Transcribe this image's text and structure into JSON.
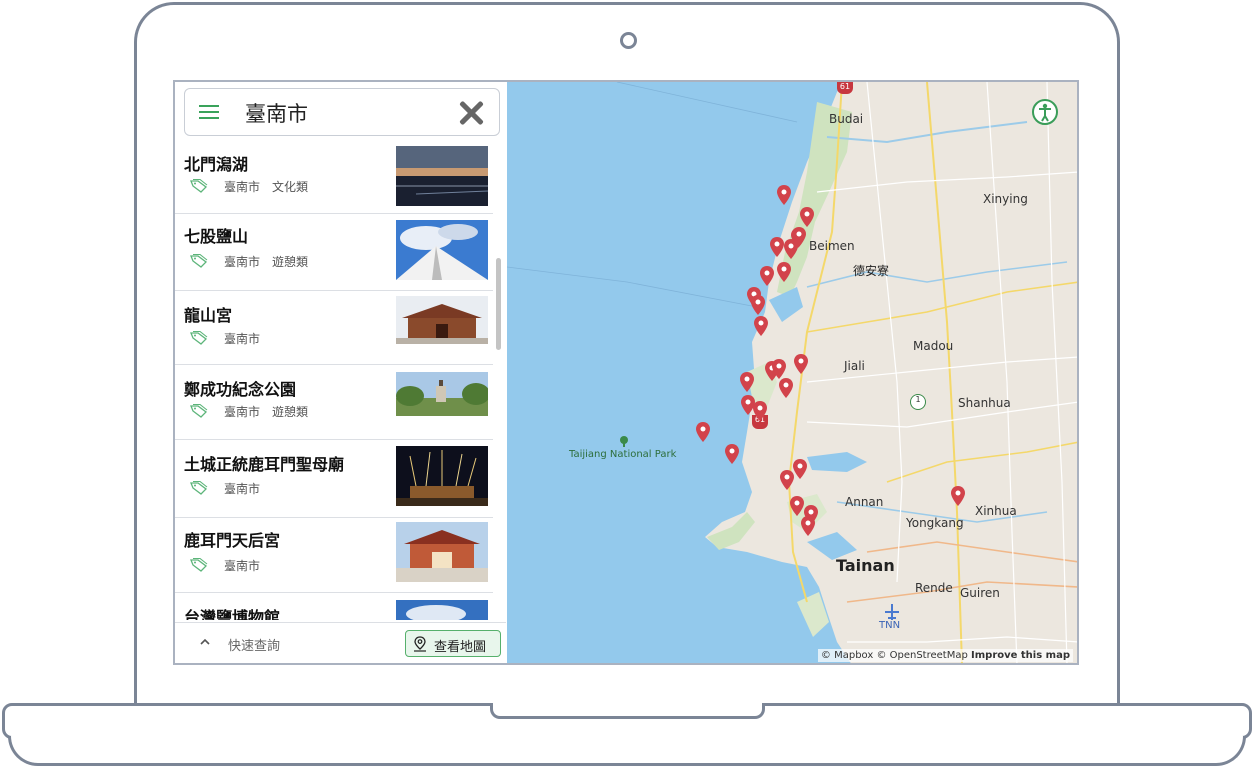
{
  "search": {
    "title": "臺南市"
  },
  "items": [
    {
      "title": "北門潟湖",
      "tags": [
        "臺南市",
        "文化類"
      ]
    },
    {
      "title": "七股鹽山",
      "tags": [
        "臺南市",
        "遊憩類"
      ]
    },
    {
      "title": "龍山宮",
      "tags": [
        "臺南市"
      ]
    },
    {
      "title": "鄭成功紀念公園",
      "tags": [
        "臺南市",
        "遊憩類"
      ]
    },
    {
      "title": "土城正統鹿耳門聖母廟",
      "tags": [
        "臺南市"
      ]
    },
    {
      "title": "鹿耳門天后宮",
      "tags": [
        "臺南市"
      ]
    },
    {
      "title": "台灣鹽博物館",
      "tags": []
    }
  ],
  "footer": {
    "quick_label": "快速查詢",
    "map_button": "查看地圖"
  },
  "map": {
    "labels": {
      "budai": "Budai",
      "xinying": "Xinying",
      "beimen": "Beimen",
      "deanliao": "德安寮",
      "madou": "Madou",
      "jiali": "Jiali",
      "shanhua": "Shanhua",
      "park": "Taijiang National Park",
      "annan": "Annan",
      "yongkang": "Yongkang",
      "xinhua": "Xinhua",
      "tainan": "Tainan",
      "rende": "Rende",
      "guiren": "Guiren",
      "tnn": "TNN",
      "route61a": "61",
      "route61b": "61",
      "route1": "1"
    },
    "attribution": {
      "mapbox": "© Mapbox © OpenStreetMap",
      "improve": "Improve this map"
    }
  },
  "colors": {
    "accent": "#3aa35b",
    "pin": "#d2434b",
    "water": "#93c9ec",
    "land": "#ece7df"
  }
}
